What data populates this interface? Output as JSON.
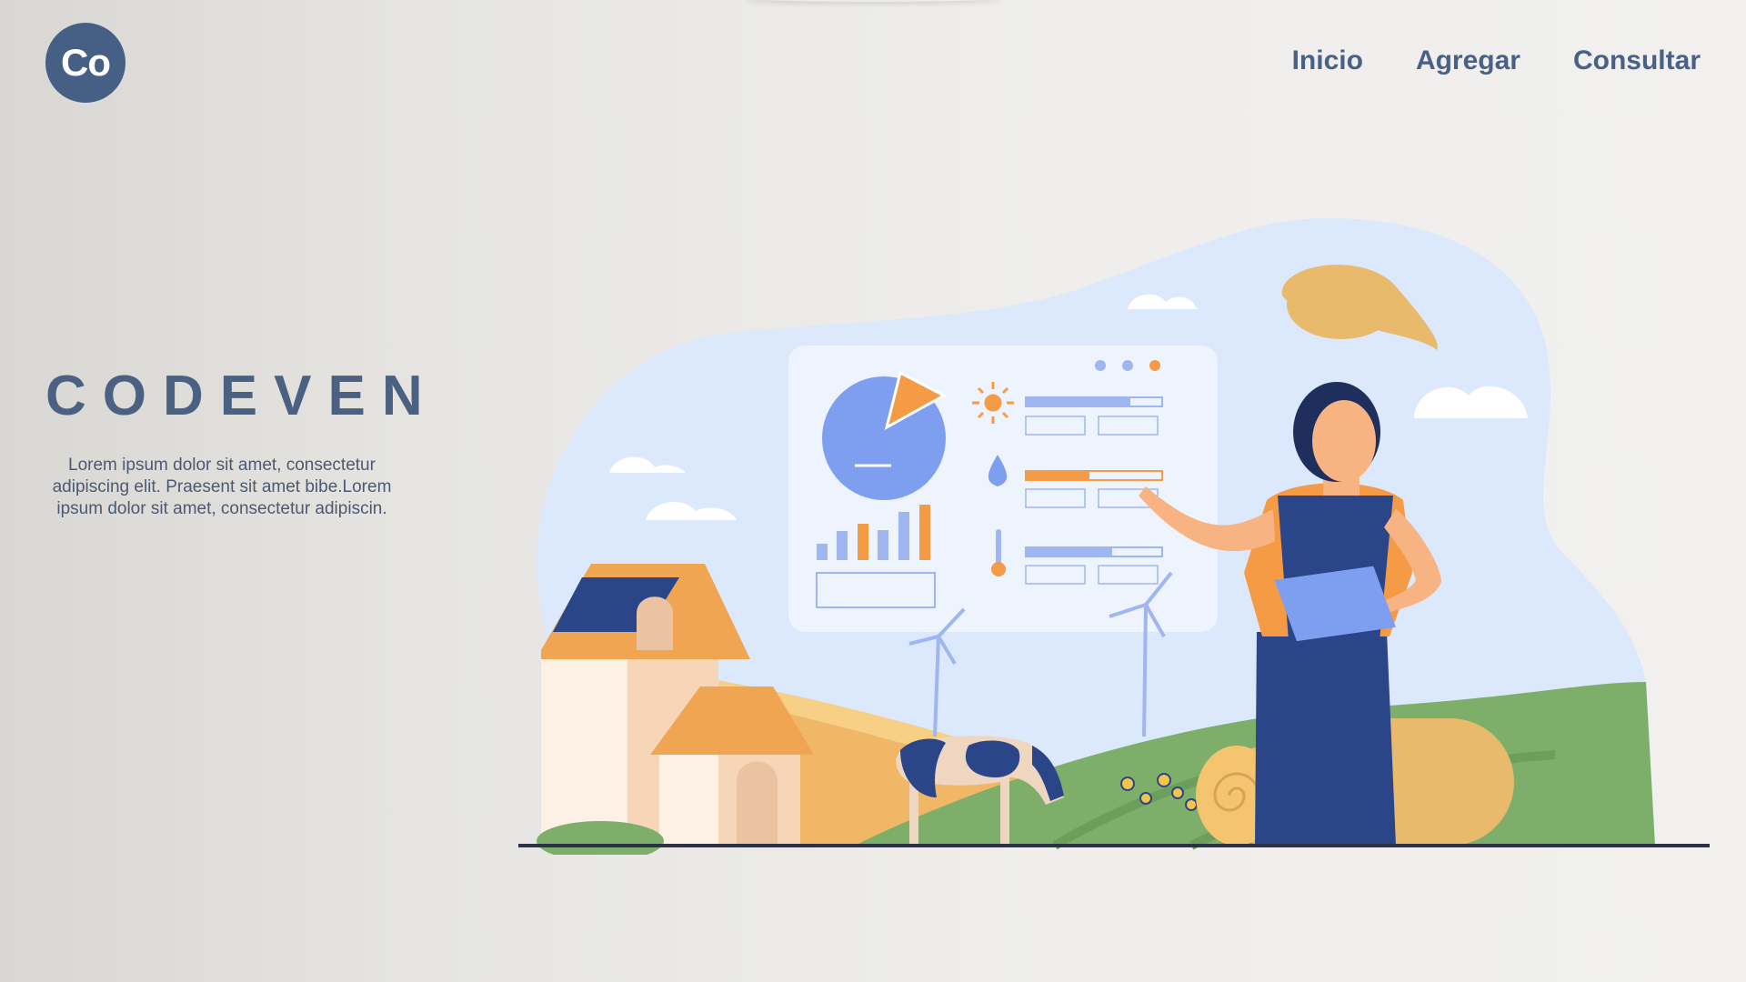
{
  "logo": {
    "text": "Co"
  },
  "nav": {
    "inicio": "Inicio",
    "agregar": "Agregar",
    "consultar": "Consultar"
  },
  "hero": {
    "brand": "CODEVEN",
    "description": "Lorem ipsum dolor sit amet, consectetur adipiscing elit. Praesent sit amet bibe.Lorem ipsum dolor sit amet, consectetur adipiscin."
  },
  "illustration": {
    "icon": "farmer-dashboard-illustration",
    "colors": {
      "sky": "#dce8fb",
      "orange": "#f59a45",
      "navy": "#2b4589",
      "blue": "#7e9ff0",
      "field": "#7eaf6a",
      "hay": "#e9b96c"
    }
  }
}
